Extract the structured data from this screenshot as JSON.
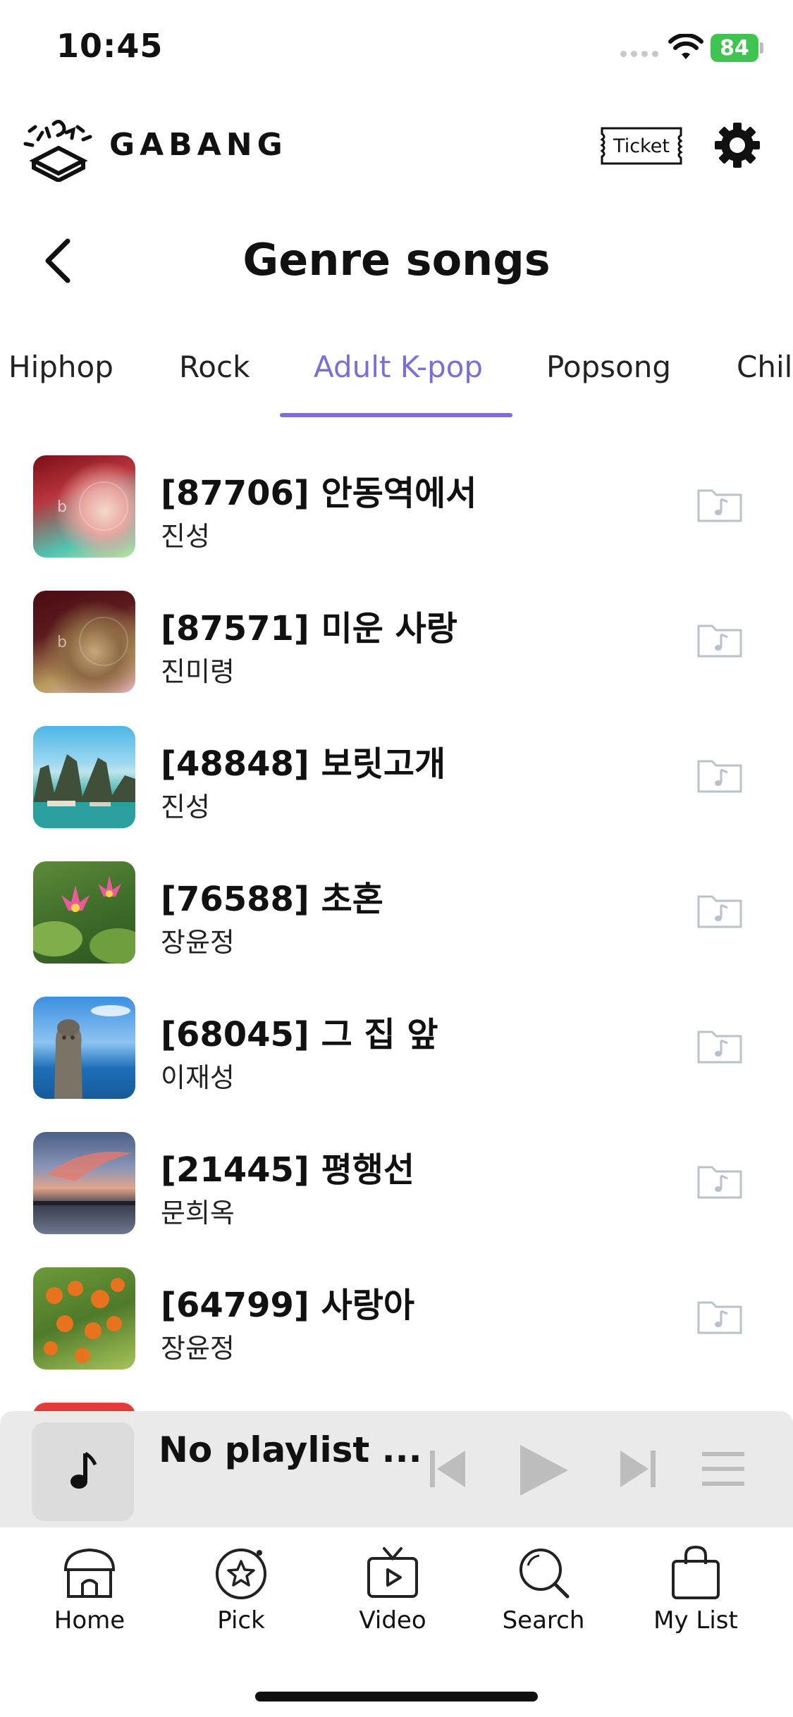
{
  "status_bar": {
    "time": "10:45",
    "battery": "84"
  },
  "header": {
    "logo_text": "GABANG",
    "ticket_label": "Ticket"
  },
  "page": {
    "title": "Genre songs"
  },
  "tabs": [
    {
      "label": "Hiphop",
      "active": false
    },
    {
      "label": "Rock",
      "active": false
    },
    {
      "label": "Adult K-pop",
      "active": true
    },
    {
      "label": "Popsong",
      "active": false
    },
    {
      "label": "Chil",
      "active": false
    }
  ],
  "songs": [
    {
      "title": "[87706] 안동역에서",
      "artist": "진성",
      "thumb": "gradient-red-teal"
    },
    {
      "title": "[87571] 미운 사랑",
      "artist": "진미령",
      "thumb": "gradient-maroon-gold"
    },
    {
      "title": "[48848] 보릿고개",
      "artist": "진성",
      "thumb": "halong-bay"
    },
    {
      "title": "[76588] 초혼",
      "artist": "장윤정",
      "thumb": "lotus-flowers"
    },
    {
      "title": "[68045] 그 집 앞",
      "artist": "이재성",
      "thumb": "stone-statue-sea"
    },
    {
      "title": "[21445] 평행선",
      "artist": "문희옥",
      "thumb": "sunset-clouds"
    },
    {
      "title": "[64799] 사랑아",
      "artist": "장윤정",
      "thumb": "persimmons"
    }
  ],
  "player": {
    "title": "No playlist ...",
    "icon": "music-note-icon"
  },
  "nav": [
    {
      "label": "Home",
      "icon": "home-icon"
    },
    {
      "label": "Pick",
      "icon": "pick-star-icon"
    },
    {
      "label": "Video",
      "icon": "video-tv-icon"
    },
    {
      "label": "Search",
      "icon": "search-icon"
    },
    {
      "label": "My List",
      "icon": "bag-icon"
    }
  ],
  "colors": {
    "accent": "#7b6fd6",
    "player_bg": "#eaeaea",
    "battery": "#3fc451"
  }
}
